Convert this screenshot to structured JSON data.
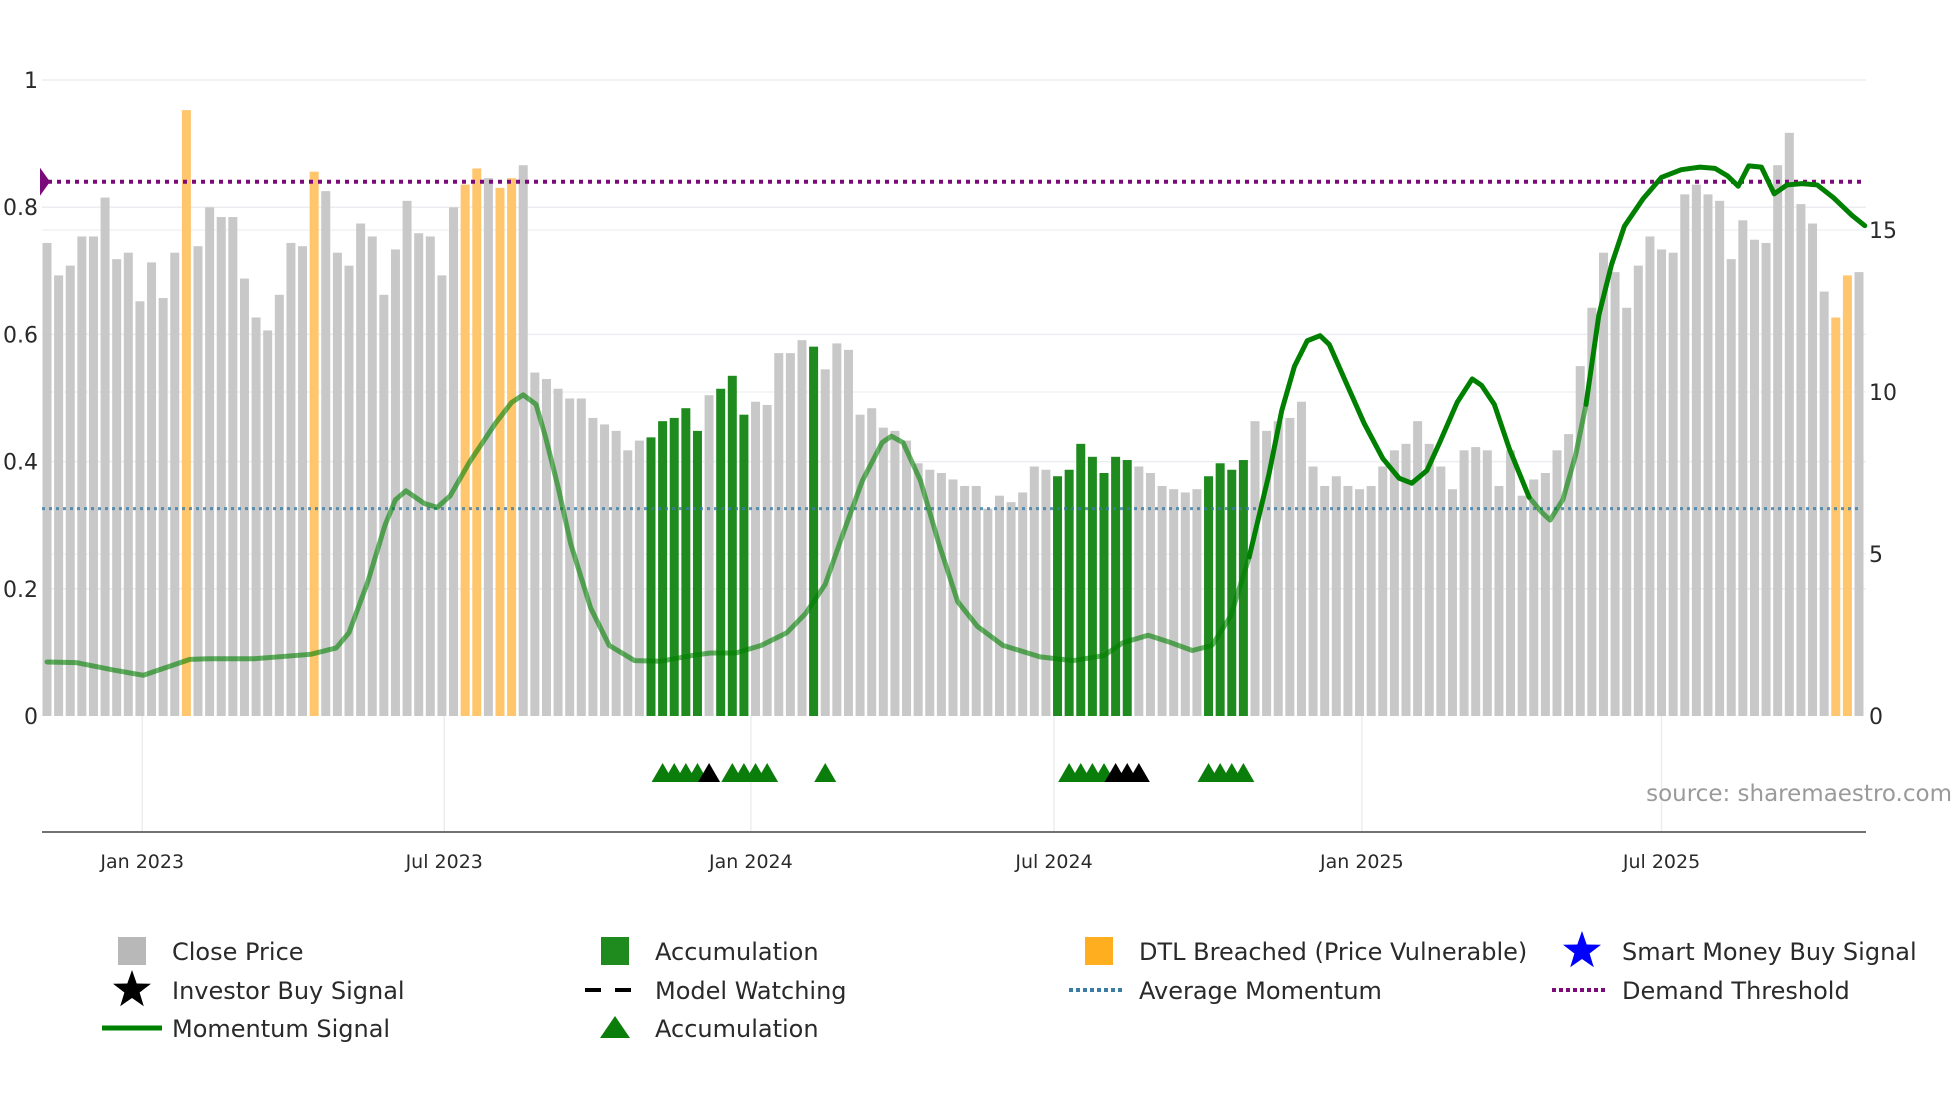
{
  "chart_data": {
    "type": "bar",
    "title": "",
    "source": "source: sharemaestro.com",
    "left_axis": {
      "range": [
        0,
        1
      ],
      "ticks": [
        "0",
        "0.2",
        "0.4",
        "0.6",
        "0.8",
        "1"
      ],
      "tick_values": [
        0,
        0.2,
        0.4,
        0.6,
        0.8,
        1
      ]
    },
    "right_axis": {
      "range": [
        0,
        19.6
      ],
      "ticks": [
        "0",
        "5",
        "10",
        "15"
      ],
      "tick_values": [
        0,
        5,
        10,
        15
      ]
    },
    "x_ticks": [
      {
        "label": "Jan 2023",
        "week": 8.2
      },
      {
        "label": "Jul 2023",
        "week": 34.2
      },
      {
        "label": "Jan 2024",
        "week": 60.6
      },
      {
        "label": "Jul 2024",
        "week": 86.7
      },
      {
        "label": "Jan 2025",
        "week": 113.2
      },
      {
        "label": "Jul 2025",
        "week": 139.0
      }
    ],
    "close_price": [
      14.6,
      13.6,
      13.9,
      14.8,
      14.8,
      16.0,
      14.1,
      14.3,
      12.8,
      14.0,
      12.9,
      14.3,
      18.7,
      14.5,
      15.7,
      15.4,
      15.4,
      13.5,
      12.3,
      11.9,
      13.0,
      14.6,
      14.5,
      16.8,
      16.2,
      14.3,
      13.9,
      15.2,
      14.8,
      13.0,
      14.4,
      15.9,
      14.9,
      14.8,
      13.6,
      15.7,
      16.4,
      16.9,
      16.6,
      16.3,
      16.6,
      17.0,
      10.6,
      10.4,
      10.1,
      9.8,
      9.8,
      9.2,
      9.0,
      8.8,
      8.2,
      8.5,
      8.6,
      9.1,
      9.2,
      9.5,
      8.8,
      9.9,
      10.1,
      10.5,
      9.3,
      9.7,
      9.6,
      11.2,
      11.2,
      11.6,
      11.4,
      10.7,
      11.5,
      11.3,
      9.3,
      9.5,
      8.9,
      8.8,
      8.5,
      7.8,
      7.6,
      7.5,
      7.3,
      7.1,
      7.1,
      6.4,
      6.8,
      6.6,
      6.9,
      7.7,
      7.6,
      7.4,
      7.6,
      8.4,
      8.0,
      7.5,
      8.0,
      7.9,
      7.7,
      7.5,
      7.1,
      7.0,
      6.9,
      7.0,
      7.4,
      7.8,
      7.6,
      7.9,
      9.1,
      8.8,
      9.1,
      9.2,
      9.7,
      7.7,
      7.1,
      7.4,
      7.1,
      7.0,
      7.1,
      7.7,
      8.2,
      8.4,
      9.1,
      8.4,
      7.7,
      7.0,
      8.2,
      8.3,
      8.2,
      7.1,
      8.2,
      6.8,
      7.3,
      7.5,
      8.2,
      8.7,
      10.8,
      12.6,
      14.3,
      13.7,
      12.6,
      13.9,
      14.8,
      14.4,
      14.3,
      16.1,
      16.4,
      16.1,
      15.9,
      14.1,
      15.3,
      14.7,
      14.6,
      17.0,
      18.0,
      15.8,
      15.2,
      13.1,
      12.3,
      13.6,
      13.7
    ],
    "bar_types": "ggggggggggggoggggggggggoggggggggggggoogoogggggggggggaaaaagaaagggggaggggggggggggggggggggaaaaaaaggggggaaaaggggggggggggggggggggggggggggggggggggggggggggggggggooggggggg",
    "momentum": [
      [
        0,
        0.085
      ],
      [
        2.5,
        0.084
      ],
      [
        5.8,
        0.072
      ],
      [
        8.3,
        0.064
      ],
      [
        12.3,
        0.089
      ],
      [
        13.9,
        0.09
      ],
      [
        17.8,
        0.09
      ],
      [
        22.7,
        0.097
      ],
      [
        24.9,
        0.107
      ],
      [
        26,
        0.131
      ],
      [
        27.6,
        0.21
      ],
      [
        29.1,
        0.3
      ],
      [
        30,
        0.34
      ],
      [
        30.9,
        0.354
      ],
      [
        32.5,
        0.334
      ],
      [
        33.6,
        0.328
      ],
      [
        34.7,
        0.346
      ],
      [
        36.4,
        0.4
      ],
      [
        38.6,
        0.46
      ],
      [
        40,
        0.493
      ],
      [
        41,
        0.505
      ],
      [
        42.1,
        0.49
      ],
      [
        42.9,
        0.44
      ],
      [
        44,
        0.36
      ],
      [
        45.1,
        0.27
      ],
      [
        46.8,
        0.17
      ],
      [
        48.4,
        0.111
      ],
      [
        50.6,
        0.087
      ],
      [
        52.8,
        0.086
      ],
      [
        55.5,
        0.095
      ],
      [
        57.1,
        0.099
      ],
      [
        59.3,
        0.099
      ],
      [
        61.5,
        0.111
      ],
      [
        63.7,
        0.131
      ],
      [
        65.3,
        0.161
      ],
      [
        67,
        0.207
      ],
      [
        68.6,
        0.29
      ],
      [
        70.2,
        0.37
      ],
      [
        71.9,
        0.43
      ],
      [
        72.7,
        0.44
      ],
      [
        73.7,
        0.43
      ],
      [
        75.2,
        0.37
      ],
      [
        76.8,
        0.27
      ],
      [
        78.4,
        0.18
      ],
      [
        80.1,
        0.141
      ],
      [
        82.3,
        0.111
      ],
      [
        85.5,
        0.093
      ],
      [
        88.3,
        0.087
      ],
      [
        91,
        0.095
      ],
      [
        92.6,
        0.115
      ],
      [
        94.8,
        0.127
      ],
      [
        96.5,
        0.117
      ],
      [
        98.6,
        0.103
      ],
      [
        100.3,
        0.111
      ],
      [
        101.9,
        0.157
      ],
      [
        103.5,
        0.25
      ],
      [
        105.2,
        0.38
      ],
      [
        106.3,
        0.48
      ],
      [
        107.4,
        0.55
      ],
      [
        108.5,
        0.59
      ],
      [
        109.6,
        0.598
      ],
      [
        110.4,
        0.584
      ],
      [
        111.7,
        0.53
      ],
      [
        113.4,
        0.46
      ],
      [
        115,
        0.405
      ],
      [
        116.4,
        0.374
      ],
      [
        117.5,
        0.366
      ],
      [
        118.8,
        0.386
      ],
      [
        119.9,
        0.43
      ],
      [
        121.4,
        0.493
      ],
      [
        122.7,
        0.53
      ],
      [
        123.5,
        0.52
      ],
      [
        124.6,
        0.49
      ],
      [
        125.9,
        0.42
      ],
      [
        127.6,
        0.344
      ],
      [
        128.7,
        0.32
      ],
      [
        129.4,
        0.308
      ],
      [
        130.5,
        0.34
      ],
      [
        131.6,
        0.41
      ],
      [
        132.5,
        0.49
      ],
      [
        133.6,
        0.63
      ],
      [
        134.7,
        0.71
      ],
      [
        135.8,
        0.77
      ],
      [
        137.4,
        0.813
      ],
      [
        139,
        0.847
      ],
      [
        140.7,
        0.859
      ],
      [
        142.3,
        0.863
      ],
      [
        143.6,
        0.861
      ],
      [
        144.7,
        0.849
      ],
      [
        145.6,
        0.833
      ],
      [
        146.5,
        0.865
      ],
      [
        147.6,
        0.863
      ],
      [
        148.7,
        0.821
      ],
      [
        149.8,
        0.835
      ],
      [
        151.1,
        0.837
      ],
      [
        152.4,
        0.835
      ],
      [
        153.8,
        0.815
      ],
      [
        155.4,
        0.787
      ],
      [
        156.5,
        0.771
      ]
    ],
    "average_momentum": 0.326,
    "demand_threshold": 0.84,
    "signals": [
      {
        "week": 53,
        "type": "accumulation"
      },
      {
        "week": 54,
        "type": "accumulation"
      },
      {
        "week": 55,
        "type": "accumulation"
      },
      {
        "week": 56,
        "type": "accumulation"
      },
      {
        "week": 57,
        "type": "investor"
      },
      {
        "week": 59,
        "type": "accumulation"
      },
      {
        "week": 60,
        "type": "accumulation"
      },
      {
        "week": 61,
        "type": "accumulation"
      },
      {
        "week": 62,
        "type": "accumulation"
      },
      {
        "week": 67,
        "type": "accumulation"
      },
      {
        "week": 88,
        "type": "accumulation"
      },
      {
        "week": 89,
        "type": "accumulation"
      },
      {
        "week": 90,
        "type": "accumulation"
      },
      {
        "week": 91,
        "type": "accumulation"
      },
      {
        "week": 92,
        "type": "investor"
      },
      {
        "week": 93,
        "type": "investor"
      },
      {
        "week": 94,
        "type": "investor"
      },
      {
        "week": 100,
        "type": "accumulation"
      },
      {
        "week": 101,
        "type": "accumulation"
      },
      {
        "week": 102,
        "type": "accumulation"
      },
      {
        "week": 103,
        "type": "accumulation"
      }
    ],
    "colors": {
      "close": "#c8c8c8",
      "accumulation": "#1f8b1f",
      "dtl": "#ffc66e",
      "momentum": "#008000",
      "avg": "#3a7ca5",
      "demand": "#7b0a7b",
      "smart": "#0000ff",
      "investor": "#000000"
    },
    "legend": [
      {
        "label": "Close Price",
        "icon": "gray-square"
      },
      {
        "label": "Accumulation",
        "icon": "green-square"
      },
      {
        "label": "DTL Breached (Price Vulnerable)",
        "icon": "orange-square"
      },
      {
        "label": "Smart Money Buy Signal",
        "icon": "blue-star"
      },
      {
        "label": "Investor Buy Signal",
        "icon": "black-star"
      },
      {
        "label": "Model Watching",
        "icon": "black-dash"
      },
      {
        "label": "Average Momentum",
        "icon": "blue-dots"
      },
      {
        "label": "Demand Threshold",
        "icon": "purple-dots"
      },
      {
        "label": "Momentum Signal",
        "icon": "green-line"
      },
      {
        "label": "Accumulation",
        "icon": "green-triangle"
      }
    ]
  }
}
